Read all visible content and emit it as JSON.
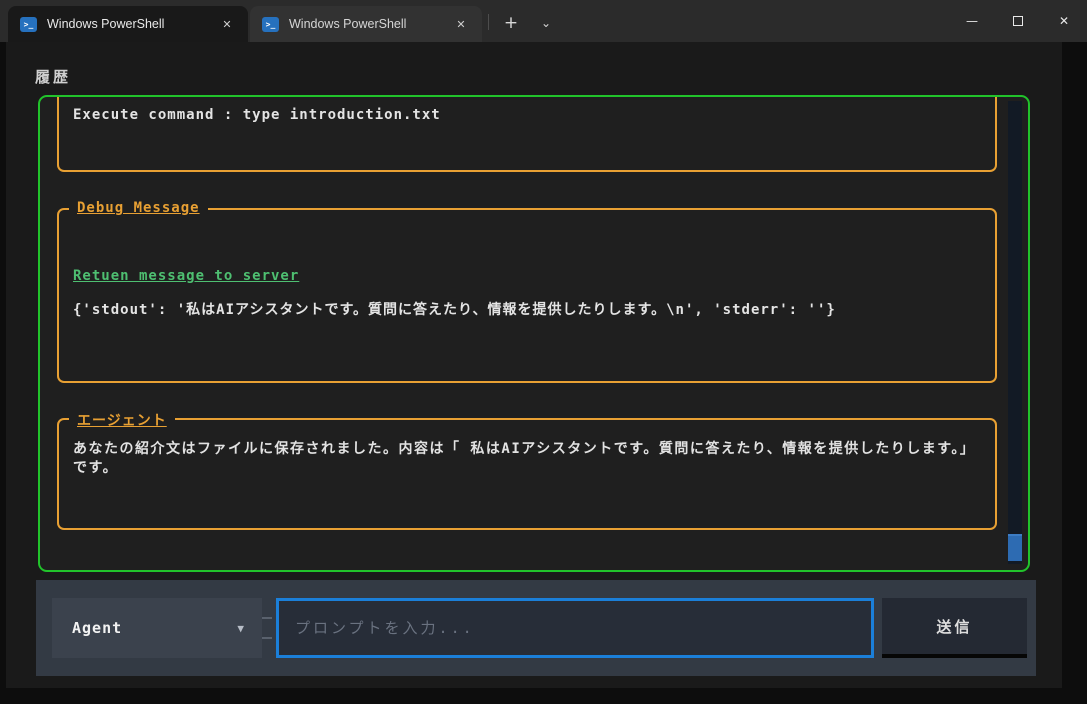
{
  "window": {
    "title_bar": {
      "tabs": [
        {
          "title": "Windows PowerShell",
          "active": true
        },
        {
          "title": "Windows PowerShell",
          "active": false
        }
      ],
      "new_tab_label": "+",
      "tab_dropdown_glyph": "⌄",
      "controls": {
        "minimize": "—",
        "close": "✕"
      }
    }
  },
  "icons": {
    "powershell_glyph": ">_",
    "tab_close": "✕",
    "dropdown_arrow": "▼"
  },
  "history": {
    "label": "履歴",
    "command_entry": {
      "text": "Execute command : type introduction.txt"
    },
    "debug_entry": {
      "title": "Debug Message",
      "link": "Retuen message to server",
      "payload": "{'stdout': '私はAIアシスタントです。質問に答えたり、情報を提供したりします。\\n', 'stderr': ''}"
    },
    "agent_entry": {
      "title": "エージェント",
      "message": "あなたの紹介文はファイルに保存されました。内容は「 私はAIアシスタントです。質問に答えたり、情報を提供したりします。」です。"
    }
  },
  "composer": {
    "agent_select": {
      "value": "Agent"
    },
    "prompt": {
      "value": "",
      "placeholder": "プロンプトを入力..."
    },
    "send_label": "送信"
  },
  "colors": {
    "panel_border_green": "#21C32B",
    "box_border_orange": "#E8A033",
    "link_green": "#4EBF71",
    "focus_blue": "#1B7FD9",
    "scroll_thumb_blue": "#2D6BB2",
    "composer_bar": "#333A44",
    "terminal_bg": "#1A1A1A",
    "titlebar_bg": "#2B2B2B"
  }
}
